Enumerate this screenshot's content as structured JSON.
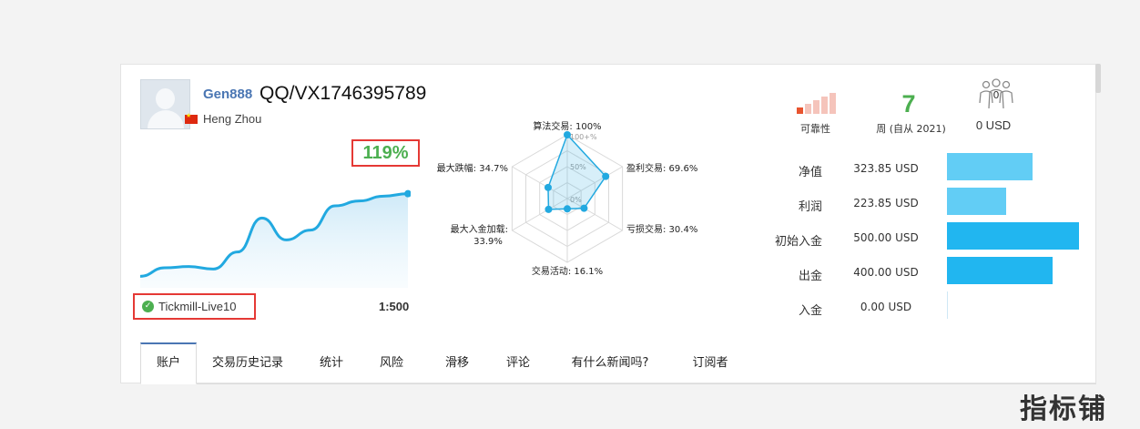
{
  "profile": {
    "name": "Gen888",
    "extra_text": "QQ/VX1746395789",
    "city": "Heng Zhou"
  },
  "growth": {
    "label": "119%",
    "curve": [
      2,
      9,
      10,
      8,
      22,
      50,
      32,
      40,
      60,
      64,
      68,
      70
    ]
  },
  "account": {
    "server": "Tickmill-Live10",
    "leverage": "1:500"
  },
  "radar": {
    "ring_labels": [
      "100+%",
      "50%",
      "0%"
    ],
    "axes": [
      {
        "label": "算法交易: 100%",
        "value": 100
      },
      {
        "label": "盈利交易: 69.6%",
        "value": 69.6
      },
      {
        "label": "亏损交易: 30.4%",
        "value": 30.4
      },
      {
        "label": "交易活动: 16.1%",
        "value": 16.1
      },
      {
        "label": "最大入金加载:",
        "label2": "33.9%",
        "value": 33.9
      },
      {
        "label": "最大跌幅: 34.7%",
        "value": 34.7
      }
    ],
    "colors": {
      "line": "#22a9e0",
      "fill": "rgba(34,169,224,0.18)",
      "grid": "#d9d9d9"
    }
  },
  "reliability": {
    "label": "可靠性",
    "level": 1,
    "max": 5,
    "colors": {
      "active": "#e8542f",
      "inactive": "#f5c4bb"
    }
  },
  "weeks": {
    "value": "7",
    "label": "周 (自从 2021)"
  },
  "subscribers": {
    "count": "0",
    "funds": "0 USD",
    "icon": "subscribers-icon"
  },
  "stats": [
    {
      "label": "净值",
      "value": "323.85 USD",
      "amount": 323.85,
      "color": "#62cdf5"
    },
    {
      "label": "利润",
      "value": "223.85 USD",
      "amount": 223.85,
      "color": "#62cdf5"
    },
    {
      "label": "初始入金",
      "value": "500.00 USD",
      "amount": 500.0,
      "color": "#21b6f0"
    },
    {
      "label": "出金",
      "value": "400.00 USD",
      "amount": 400.0,
      "color": "#21b6f0"
    },
    {
      "label": "入金",
      "value": "0.00 USD",
      "amount": 0.0,
      "color": "#21b6f0"
    }
  ],
  "tabs": [
    "账户",
    "交易历史记录",
    "统计",
    "风险",
    "滑移",
    "评论",
    "有什么新闻吗?",
    "订阅者"
  ],
  "active_tab": 0,
  "watermark": "指标铺"
}
